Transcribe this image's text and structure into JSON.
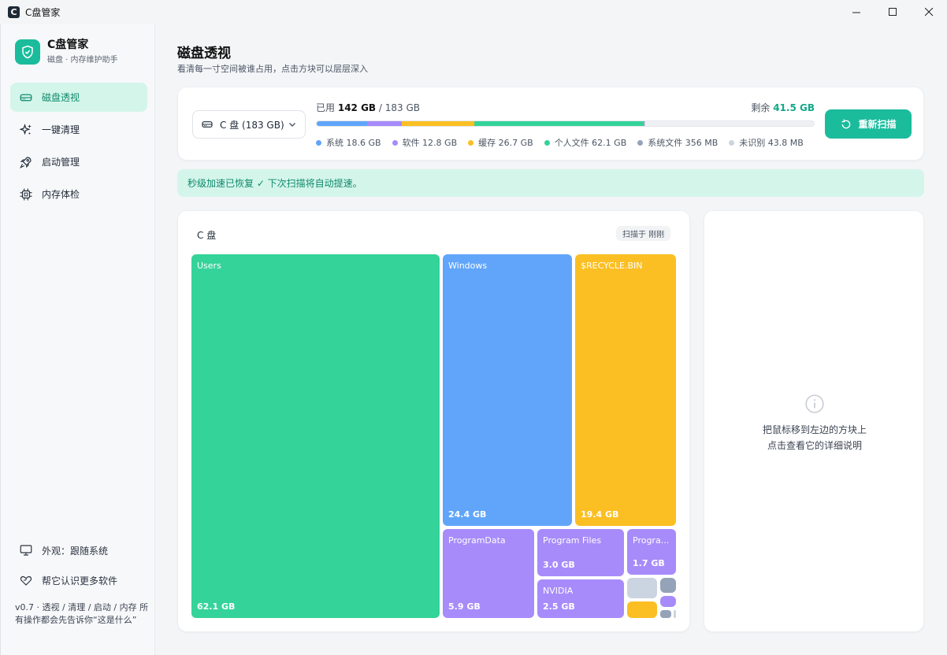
{
  "window": {
    "title": "C盘管家",
    "app_icon_letter": "C"
  },
  "brand": {
    "title": "C盘管家",
    "subtitle": "磁盘 · 内存维护助手"
  },
  "nav": [
    {
      "label": "磁盘透视",
      "icon": "drive-icon",
      "active": true
    },
    {
      "label": "一键清理",
      "icon": "sparkle-icon",
      "active": false
    },
    {
      "label": "启动管理",
      "icon": "rocket-icon",
      "active": false
    },
    {
      "label": "内存体检",
      "icon": "chip-icon",
      "active": false
    }
  ],
  "sidebar_bottom": {
    "appearance": "外观：跟随系统",
    "help": "帮它认识更多软件",
    "version": "v0.7 · 透视 / 清理 / 启动 / 内存 所有操作都会先告诉你“这是什么”"
  },
  "page": {
    "title": "磁盘透视",
    "subtitle": "看清每一寸空间被谁占用，点击方块可以层层深入"
  },
  "drive": {
    "selected": "C 盘 (183 GB)"
  },
  "usage": {
    "used_label": "已用",
    "used": "142 GB",
    "total": "183 GB",
    "free_label": "剩余",
    "free": "41.5 GB",
    "segments": [
      {
        "name": "系统",
        "size": "18.6 GB",
        "gb": 18.6,
        "color": "#60a5fa"
      },
      {
        "name": "软件",
        "size": "12.8 GB",
        "gb": 12.8,
        "color": "#a78bfa"
      },
      {
        "name": "缓存",
        "size": "26.7 GB",
        "gb": 26.7,
        "color": "#fbbf24"
      },
      {
        "name": "个人文件",
        "size": "62.1 GB",
        "gb": 62.1,
        "color": "#34d399"
      },
      {
        "name": "系统文件",
        "size": "356 MB",
        "gb": 0.356,
        "color": "#94a3b8"
      },
      {
        "name": "未识别",
        "size": "43.8 MB",
        "gb": 0.0438,
        "color": "#cbd5e1"
      }
    ],
    "rescan": "重新扫描"
  },
  "notice": "秒级加速已恢复 ✓ 下次扫描将自动提速。",
  "treemap": {
    "title": "C 盘",
    "scan_status": "扫描于 刚刚",
    "tiles": [
      {
        "name": "Users",
        "size": "62.1 GB",
        "color": "#34d399"
      },
      {
        "name": "Windows",
        "size": "24.4 GB",
        "color": "#60a5fa"
      },
      {
        "name": "$RECYCLE.BIN",
        "size": "19.4 GB",
        "color": "#fbbf24"
      },
      {
        "name": "ProgramData",
        "size": "5.9 GB",
        "color": "#a78bfa"
      },
      {
        "name": "Program Files",
        "size": "3.0 GB",
        "color": "#a78bfa"
      },
      {
        "name": "Progra...",
        "size": "1.7 GB",
        "color": "#a78bfa"
      },
      {
        "name": "NVIDIA",
        "size": "2.5 GB",
        "color": "#a78bfa"
      }
    ]
  },
  "detail": {
    "hint_line1": "把鼠标移到左边的方块上",
    "hint_line2": "点击查看它的详细说明"
  }
}
